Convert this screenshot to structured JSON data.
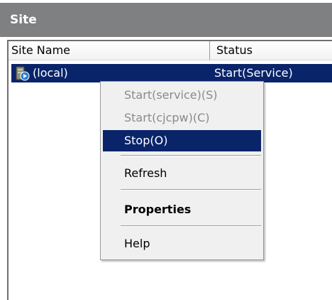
{
  "window": {
    "title": "Site"
  },
  "list": {
    "columns": [
      "Site Name",
      "Status"
    ],
    "rows": [
      {
        "name": "(local)",
        "status": "Start(Service)",
        "icon": "server-site-icon",
        "selected": true
      }
    ]
  },
  "context_menu": {
    "items": [
      {
        "label": "Start(service)(S)",
        "enabled": false
      },
      {
        "label": "Start(cjcpw)(C)",
        "enabled": false
      },
      {
        "label": "Stop(O)",
        "enabled": true,
        "highlighted": true
      },
      {
        "label": "Refresh",
        "enabled": true
      },
      {
        "label": "Properties",
        "enabled": true,
        "bold": true
      },
      {
        "label": "Help",
        "enabled": true
      }
    ]
  },
  "colors": {
    "title_bar": "#7f8081",
    "selection": "#0a246a",
    "menu_background": "#f0f0f0",
    "disabled_text": "#8a8a8a"
  }
}
